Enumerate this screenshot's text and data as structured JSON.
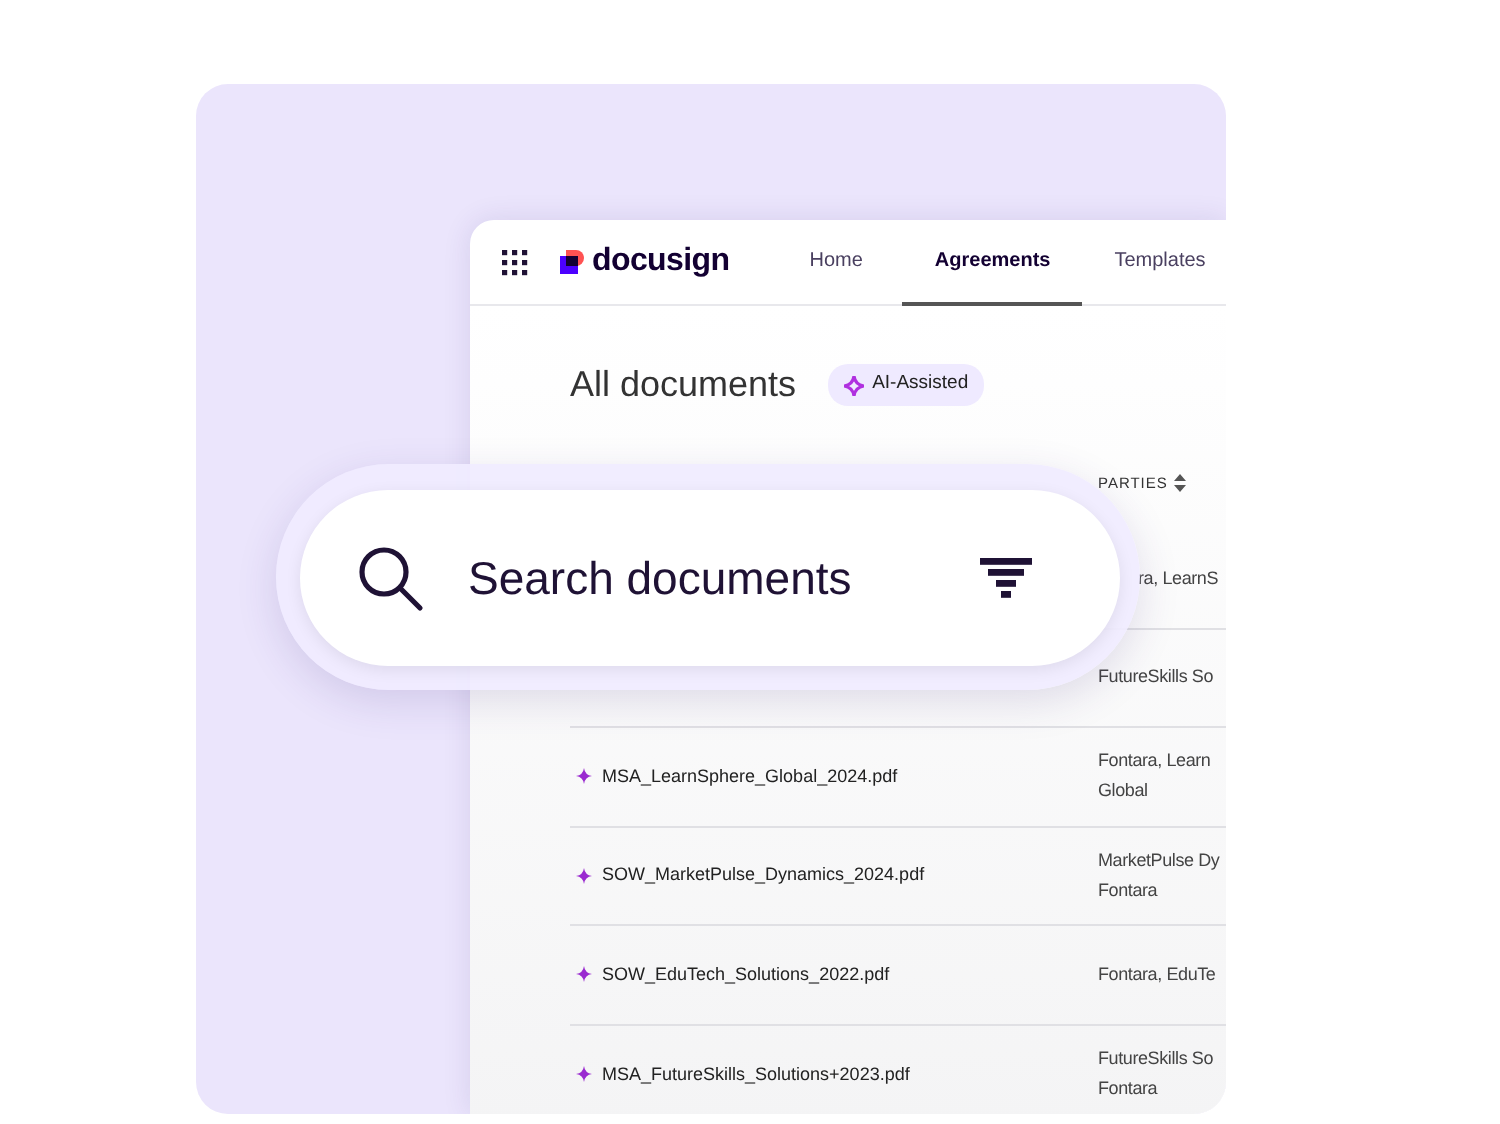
{
  "app": {
    "logo": "docusign",
    "tabs": [
      {
        "label": "Home",
        "selected": false
      },
      {
        "label": "Agreements",
        "selected": true
      },
      {
        "label": "Templates",
        "selected": false
      }
    ],
    "page_title": "All documents",
    "badge": "AI-Assisted",
    "table": {
      "columns": [
        {
          "label": "PARTIES",
          "sortable": true
        }
      ],
      "rows": [
        {
          "parties": [
            "ra, LearnS"
          ]
        },
        {
          "parties": [
            "FutureSkills So"
          ]
        },
        {
          "name": "MSA_LearnSphere_Global_2024.pdf",
          "parties": [
            "Fontara, Learn",
            "Global"
          ]
        },
        {
          "name": "SOW_MarketPulse_Dynamics_2024.pdf",
          "parties": [
            "MarketPulse Dy",
            "Fontara"
          ]
        },
        {
          "name": "SOW_EduTech_Solutions_2022.pdf",
          "parties": [
            "Fontara, EduTe"
          ]
        },
        {
          "name": "MSA_FutureSkills_Solutions+2023.pdf",
          "parties": [
            "FutureSkills So",
            "Fontara"
          ]
        }
      ]
    }
  },
  "search": {
    "placeholder": "Search documents"
  }
}
